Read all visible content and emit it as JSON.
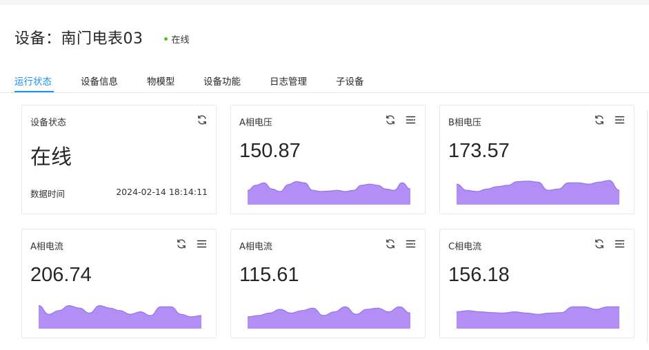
{
  "device": {
    "title": "设备：南门电表03",
    "status": "在线",
    "status_color": "#52c41a"
  },
  "tabs": [
    {
      "label": "运行状态",
      "active": true
    },
    {
      "label": "设备信息"
    },
    {
      "label": "物模型"
    },
    {
      "label": "设备功能"
    },
    {
      "label": "日志管理"
    },
    {
      "label": "子设备"
    }
  ],
  "status_card": {
    "title": "设备状态",
    "value": "在线",
    "time_label": "数据时间",
    "time_value": "2024-02-14 18:14:11",
    "icon": "refresh-icon"
  },
  "metrics": [
    {
      "title": "A相电压",
      "value": "150.87",
      "spark": [
        0.55,
        0.75,
        0.85,
        0.6,
        0.5,
        0.78,
        0.9,
        0.85,
        0.55,
        0.5,
        0.52,
        0.55,
        0.5,
        0.55,
        0.75,
        0.8,
        0.75,
        0.6,
        0.55,
        0.85,
        0.6
      ]
    },
    {
      "title": "B相电压",
      "value": "173.57",
      "spark": [
        0.8,
        0.55,
        0.5,
        0.6,
        0.7,
        0.75,
        0.9,
        0.92,
        0.88,
        0.55,
        0.6,
        0.85,
        0.85,
        0.8,
        0.88,
        0.95,
        0.55
      ]
    },
    {
      "title": "A相电流",
      "value": "206.74",
      "spark": [
        0.9,
        0.55,
        0.7,
        0.9,
        0.8,
        0.6,
        0.9,
        0.8,
        0.7,
        0.55,
        0.65,
        0.5,
        0.85,
        0.85,
        0.55,
        0.45,
        0.5
      ]
    },
    {
      "title": "A相电流",
      "value": "115.61",
      "spark": [
        0.45,
        0.5,
        0.6,
        0.75,
        0.6,
        0.7,
        0.8,
        0.5,
        0.65,
        0.85,
        0.55,
        0.75,
        0.8,
        0.65,
        0.85,
        0.6
      ]
    },
    {
      "title": "C相电流",
      "value": "156.18",
      "spark": [
        0.65,
        0.7,
        0.65,
        0.62,
        0.6,
        0.65,
        0.6,
        0.55,
        0.6,
        0.62,
        0.85,
        0.85,
        0.75,
        0.85,
        0.85
      ]
    }
  ],
  "icons": {
    "refresh": "refresh-icon",
    "list": "list-icon"
  },
  "colors": {
    "accent": "#1890ff",
    "spark_fill": "#b38ff5",
    "spark_line": "#8f74f0"
  }
}
